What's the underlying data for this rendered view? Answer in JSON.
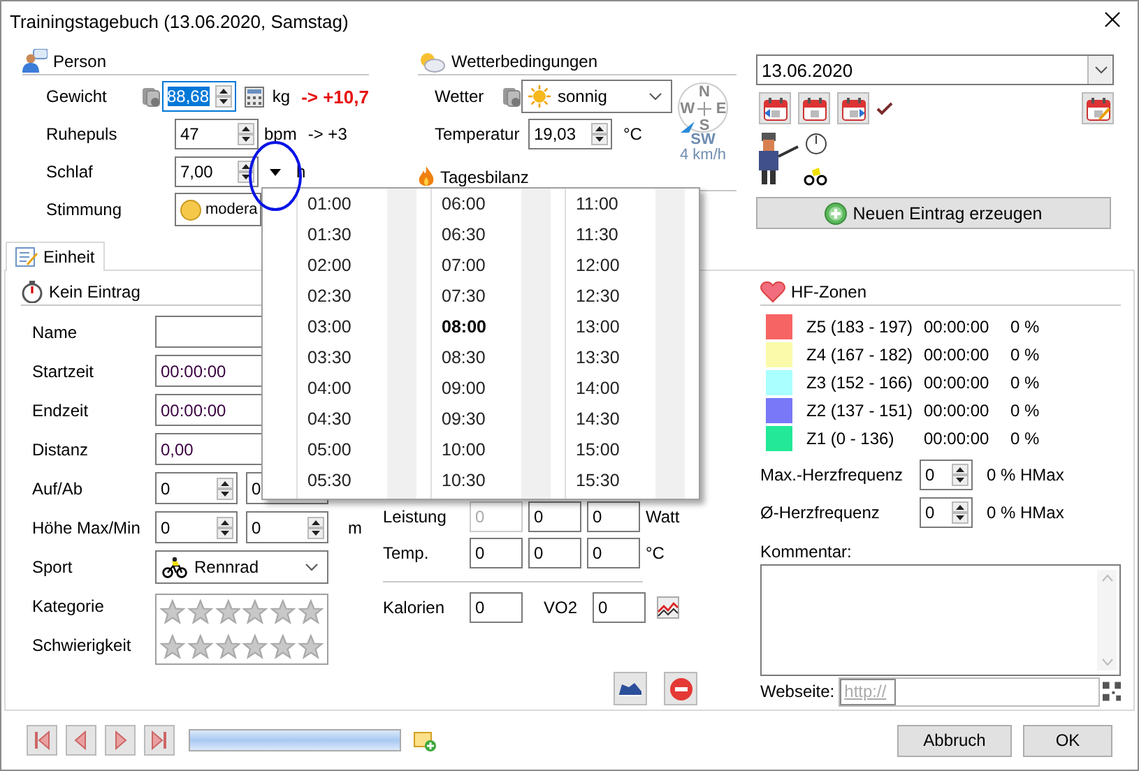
{
  "window": {
    "title": "Trainingstagebuch (13.06.2020, Samstag)"
  },
  "person": {
    "title": "Person",
    "rows": [
      {
        "kind": "weight",
        "label": "Gewicht",
        "value": "88,68",
        "text_selected": true,
        "unit": "kg",
        "delta": "-> +10,7",
        "alert": true
      },
      {
        "kind": "pulse",
        "label": "Ruhepuls",
        "value": "47",
        "text_selected": false,
        "unit": "bpm",
        "delta": "-> +3",
        "alert": false
      },
      {
        "kind": "sleep",
        "label": "Schlaf",
        "value": "7,00",
        "text_selected": false,
        "unit": "h"
      },
      {
        "kind": "mood",
        "label": "Stimmung",
        "value": "modera"
      }
    ]
  },
  "weather": {
    "title": "Wetterbedingungen",
    "condition_label": "Wetter",
    "condition": "sonnig",
    "temperature_label": "Temperatur",
    "temperature": "19,03",
    "temperature_unit": "°C",
    "compass": {
      "north": "N",
      "east": "E",
      "south": "S",
      "west": "W"
    },
    "wind_direction": "SW",
    "wind_speed": "4 km/h"
  },
  "balance": {
    "title": "Tagesbilanz"
  },
  "date_picker": {
    "value": "13.06.2020"
  },
  "new_entry_button": "Neuen Eintrag erzeugen",
  "tabs": [
    {
      "label": "Einheit",
      "selected": true
    }
  ],
  "unit": {
    "title": "Kein Eintrag",
    "fields": [
      {
        "kind": "text",
        "label": "Name"
      },
      {
        "kind": "text",
        "label": "Startzeit",
        "value": "00:00:00"
      },
      {
        "kind": "text",
        "label": "Endzeit",
        "value": "00:00:00"
      },
      {
        "kind": "text",
        "label": "Distanz",
        "value": "0,00"
      },
      {
        "kind": "spin-pair",
        "label": "Auf/Ab",
        "values": [
          "0",
          "0"
        ]
      },
      {
        "kind": "spin-pair",
        "label": "Höhe Max/Min",
        "values": [
          "0",
          "0"
        ],
        "unit": "m"
      },
      {
        "kind": "select",
        "label": "Sport",
        "value": "Rennrad"
      },
      {
        "kind": "stars",
        "label": "Kategorie",
        "stars": 0
      },
      {
        "kind": "stars",
        "label": "Schwierigkeit",
        "stars": 0
      }
    ]
  },
  "metrics": {
    "rows": [
      {
        "label": "Leistung",
        "fields": [
          {
            "value": "0",
            "disabled": true
          },
          {
            "value": "0",
            "disabled": false
          },
          {
            "value": "0",
            "disabled": false
          }
        ],
        "unit": "Watt"
      },
      {
        "label": "Temp.",
        "fields": [
          {
            "value": "0",
            "disabled": false
          },
          {
            "value": "0",
            "disabled": false
          },
          {
            "value": "0",
            "disabled": false
          }
        ],
        "unit": "°C"
      }
    ],
    "calories": {
      "label": "Kalorien",
      "value": "0"
    },
    "vo2": {
      "label": "VO2",
      "value": "0"
    }
  },
  "hf_zones": {
    "title": "HF-Zonen",
    "zones": [
      {
        "label": "Z5 (183 - 197)",
        "time": "00:00:00",
        "percent": "0 %",
        "color": "#f76464"
      },
      {
        "label": "Z4 (167 - 182)",
        "time": "00:00:00",
        "percent": "0 %",
        "color": "#fafaaa"
      },
      {
        "label": "Z3 (152 - 166)",
        "time": "00:00:00",
        "percent": "0 %",
        "color": "#aaffff"
      },
      {
        "label": "Z2 (137 - 151)",
        "time": "00:00:00",
        "percent": "0 %",
        "color": "#7878f8"
      },
      {
        "label": "Z1 (0 - 136)",
        "time": "00:00:00",
        "percent": "0 %",
        "color": "#22e898"
      }
    ],
    "max": {
      "label": "Max.-Herzfrequenz",
      "value": "0",
      "percent": "0 % HMax"
    },
    "avg": {
      "label": "Ø-Herzfrequenz",
      "value": "0",
      "percent": "0 % HMax"
    }
  },
  "comment": {
    "label": "Kommentar:"
  },
  "website": {
    "label": "Webseite:",
    "placeholder": "http://"
  },
  "progress": {
    "level": 1
  },
  "buttons": [
    "Abbruch",
    "OK"
  ],
  "time_popup": {
    "columns": [
      {
        "times": [
          {
            "time": "01:00",
            "selected": false
          },
          {
            "time": "01:30",
            "selected": false
          },
          {
            "time": "02:00",
            "selected": false
          },
          {
            "time": "02:30",
            "selected": false
          },
          {
            "time": "03:00",
            "selected": false
          },
          {
            "time": "03:30",
            "selected": false
          },
          {
            "time": "04:00",
            "selected": false
          },
          {
            "time": "04:30",
            "selected": false
          },
          {
            "time": "05:00",
            "selected": false
          },
          {
            "time": "05:30",
            "selected": false
          }
        ]
      },
      {
        "times": [
          {
            "time": "06:00",
            "selected": false
          },
          {
            "time": "06:30",
            "selected": false
          },
          {
            "time": "07:00",
            "selected": false
          },
          {
            "time": "07:30",
            "selected": false
          },
          {
            "time": "08:00",
            "selected": true
          },
          {
            "time": "08:30",
            "selected": false
          },
          {
            "time": "09:00",
            "selected": false
          },
          {
            "time": "09:30",
            "selected": false
          },
          {
            "time": "10:00",
            "selected": false
          },
          {
            "time": "10:30",
            "selected": false
          }
        ]
      },
      {
        "times": [
          {
            "time": "11:00",
            "selected": false
          },
          {
            "time": "11:30",
            "selected": false
          },
          {
            "time": "12:00",
            "selected": false
          },
          {
            "time": "12:30",
            "selected": false
          },
          {
            "time": "13:00",
            "selected": false
          },
          {
            "time": "13:30",
            "selected": false
          },
          {
            "time": "14:00",
            "selected": false
          },
          {
            "time": "14:30",
            "selected": false
          },
          {
            "time": "15:00",
            "selected": false
          },
          {
            "time": "15:30",
            "selected": false
          }
        ]
      }
    ]
  }
}
